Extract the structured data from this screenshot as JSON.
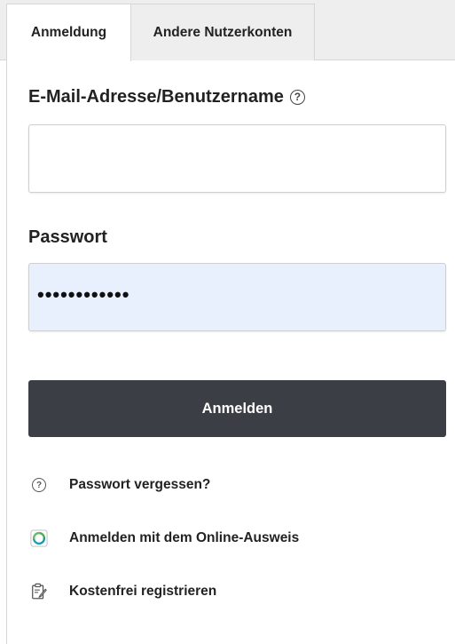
{
  "tabs": {
    "active_label": "Anmeldung",
    "other_label": "Andere Nutzerkonten"
  },
  "form": {
    "email_label": "E-Mail-Adresse/Benutzername",
    "email_value": "",
    "password_label": "Passwort",
    "password_value": "••••••••••••",
    "submit_label": "Anmelden"
  },
  "links": {
    "forgot_password": "Passwort vergessen?",
    "online_id": "Anmelden mit dem Online-Ausweis",
    "register": "Kostenfrei registrieren"
  },
  "icons": {
    "help": "question-circle-icon",
    "online_id": "online-ausweis-icon",
    "register": "clipboard-edit-icon"
  },
  "colors": {
    "button_bg": "#3c3e45",
    "password_bg": "#e8f0fe",
    "online_id_teal": "#1aa3b1",
    "online_id_green": "#4caf50"
  }
}
